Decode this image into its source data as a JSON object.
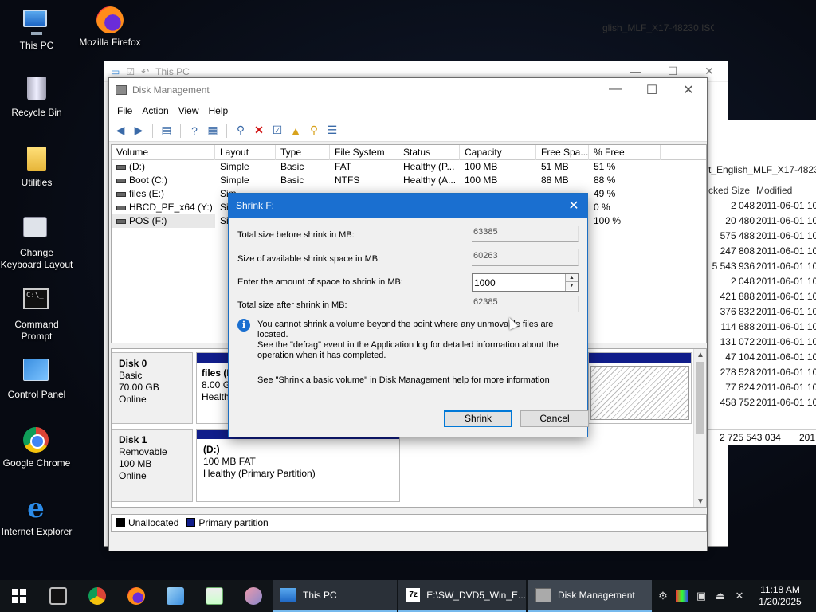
{
  "desktop": {
    "icons": [
      {
        "label": "This PC"
      },
      {
        "label": "Mozilla Firefox"
      },
      {
        "label": "Recycle Bin"
      },
      {
        "label": "Utilities"
      },
      {
        "label": "Change\nKeyboard Layout"
      },
      {
        "label": "Command\nPrompt"
      },
      {
        "label": "Control Panel"
      },
      {
        "label": "Google Chrome"
      },
      {
        "label": "Internet Explorer"
      }
    ]
  },
  "explorer": {
    "title": "This PC",
    "path_fragment": "glish_MLF_X17-48230.ISO\\s",
    "folder_fragment": "t_English_MLF_X17-48230.",
    "col_size": "cked Size",
    "col_modified": "Modified",
    "rows": [
      {
        "size": "2 048",
        "date": "2011-06-01 10:"
      },
      {
        "size": "20 480",
        "date": "2011-06-01 10:"
      },
      {
        "size": "575 488",
        "date": "2011-06-01 10:"
      },
      {
        "size": "247 808",
        "date": "2011-06-01 10:"
      },
      {
        "size": "5 543 936",
        "date": "2011-06-01 10:"
      },
      {
        "size": "2 048",
        "date": "2011-06-01 10:"
      },
      {
        "size": "421 888",
        "date": "2011-06-01 10:"
      },
      {
        "size": "376 832",
        "date": "2011-06-01 10:"
      },
      {
        "size": "114 688",
        "date": "2011-06-01 10:"
      },
      {
        "size": "131 072",
        "date": "2011-06-01 10:"
      },
      {
        "size": "47 104",
        "date": "2011-06-01 10:"
      },
      {
        "size": "278 528",
        "date": "2011-06-01 10:"
      },
      {
        "size": "77 824",
        "date": "2011-06-01 10:"
      },
      {
        "size": "458 752",
        "date": "2011-06-01 10:"
      }
    ],
    "total_size": "2 725 543 034",
    "total_date": "201"
  },
  "dm": {
    "title": "Disk Management",
    "menu": [
      "File",
      "Action",
      "View",
      "Help"
    ],
    "columns": [
      "Volume",
      "Layout",
      "Type",
      "File System",
      "Status",
      "Capacity",
      "Free Spa...",
      "% Free"
    ],
    "volumes": [
      {
        "volume": "(D:)",
        "layout": "Simple",
        "type": "Basic",
        "fs": "FAT",
        "status": "Healthy (P...",
        "capacity": "100 MB",
        "free": "51 MB",
        "pct": "51 %"
      },
      {
        "volume": "Boot (C:)",
        "layout": "Simple",
        "type": "Basic",
        "fs": "NTFS",
        "status": "Healthy (A...",
        "capacity": "100 MB",
        "free": "88 MB",
        "pct": "88 %"
      },
      {
        "volume": "files (E:)",
        "layout": "Sim",
        "type": "",
        "fs": "",
        "status": "",
        "capacity": "",
        "free": "",
        "pct": "49 %"
      },
      {
        "volume": "HBCD_PE_x64 (Y:)",
        "layout": "Sir",
        "type": "",
        "fs": "",
        "status": "",
        "capacity": "",
        "free": "",
        "pct": "0 %"
      },
      {
        "volume": "POS (F:)",
        "layout": "Sir",
        "type": "",
        "fs": "",
        "status": "",
        "capacity": "",
        "free": "",
        "pct": "100 %"
      }
    ],
    "disk0": {
      "name": "Disk 0",
      "kind": "Basic",
      "size": "70.00 GB",
      "state": "Online",
      "part_name": "files (E",
      "part_size": "8.00 GB",
      "part_status": "Healthy"
    },
    "disk1": {
      "name": "Disk 1",
      "kind": "Removable",
      "size": "100 MB",
      "state": "Online",
      "part_name": "(D:)",
      "part_size": "100 MB FAT",
      "part_status": "Healthy (Primary Partition)"
    },
    "legend": {
      "unallocated": "Unallocated",
      "primary": "Primary partition",
      "unalloc_color": "#000000",
      "primary_color": "#101d8a"
    }
  },
  "dialog": {
    "title": "Shrink F:",
    "total_before_label": "Total size before shrink in MB:",
    "total_before_value": "63385",
    "available_label": "Size of available shrink space in MB:",
    "available_value": "60263",
    "amount_label": "Enter the amount of space to shrink in MB:",
    "amount_value": "1000",
    "total_after_label": "Total size after shrink in MB:",
    "total_after_value": "62385",
    "info": "You cannot shrink a volume beyond the point where any unmovable files are located.\nSee the \"defrag\" event in the Application log for detailed information about the\noperation when it has completed.",
    "help": "See \"Shrink a basic volume\" in Disk Management help for more information",
    "shrink_label": "Shrink",
    "cancel_label": "Cancel"
  },
  "taskbar": {
    "tasks": [
      {
        "label": "This PC"
      },
      {
        "label": "E:\\SW_DVD5_Win_E..."
      },
      {
        "label": "Disk Management"
      }
    ],
    "time": "11:18 AM",
    "date": "1/20/2025"
  }
}
